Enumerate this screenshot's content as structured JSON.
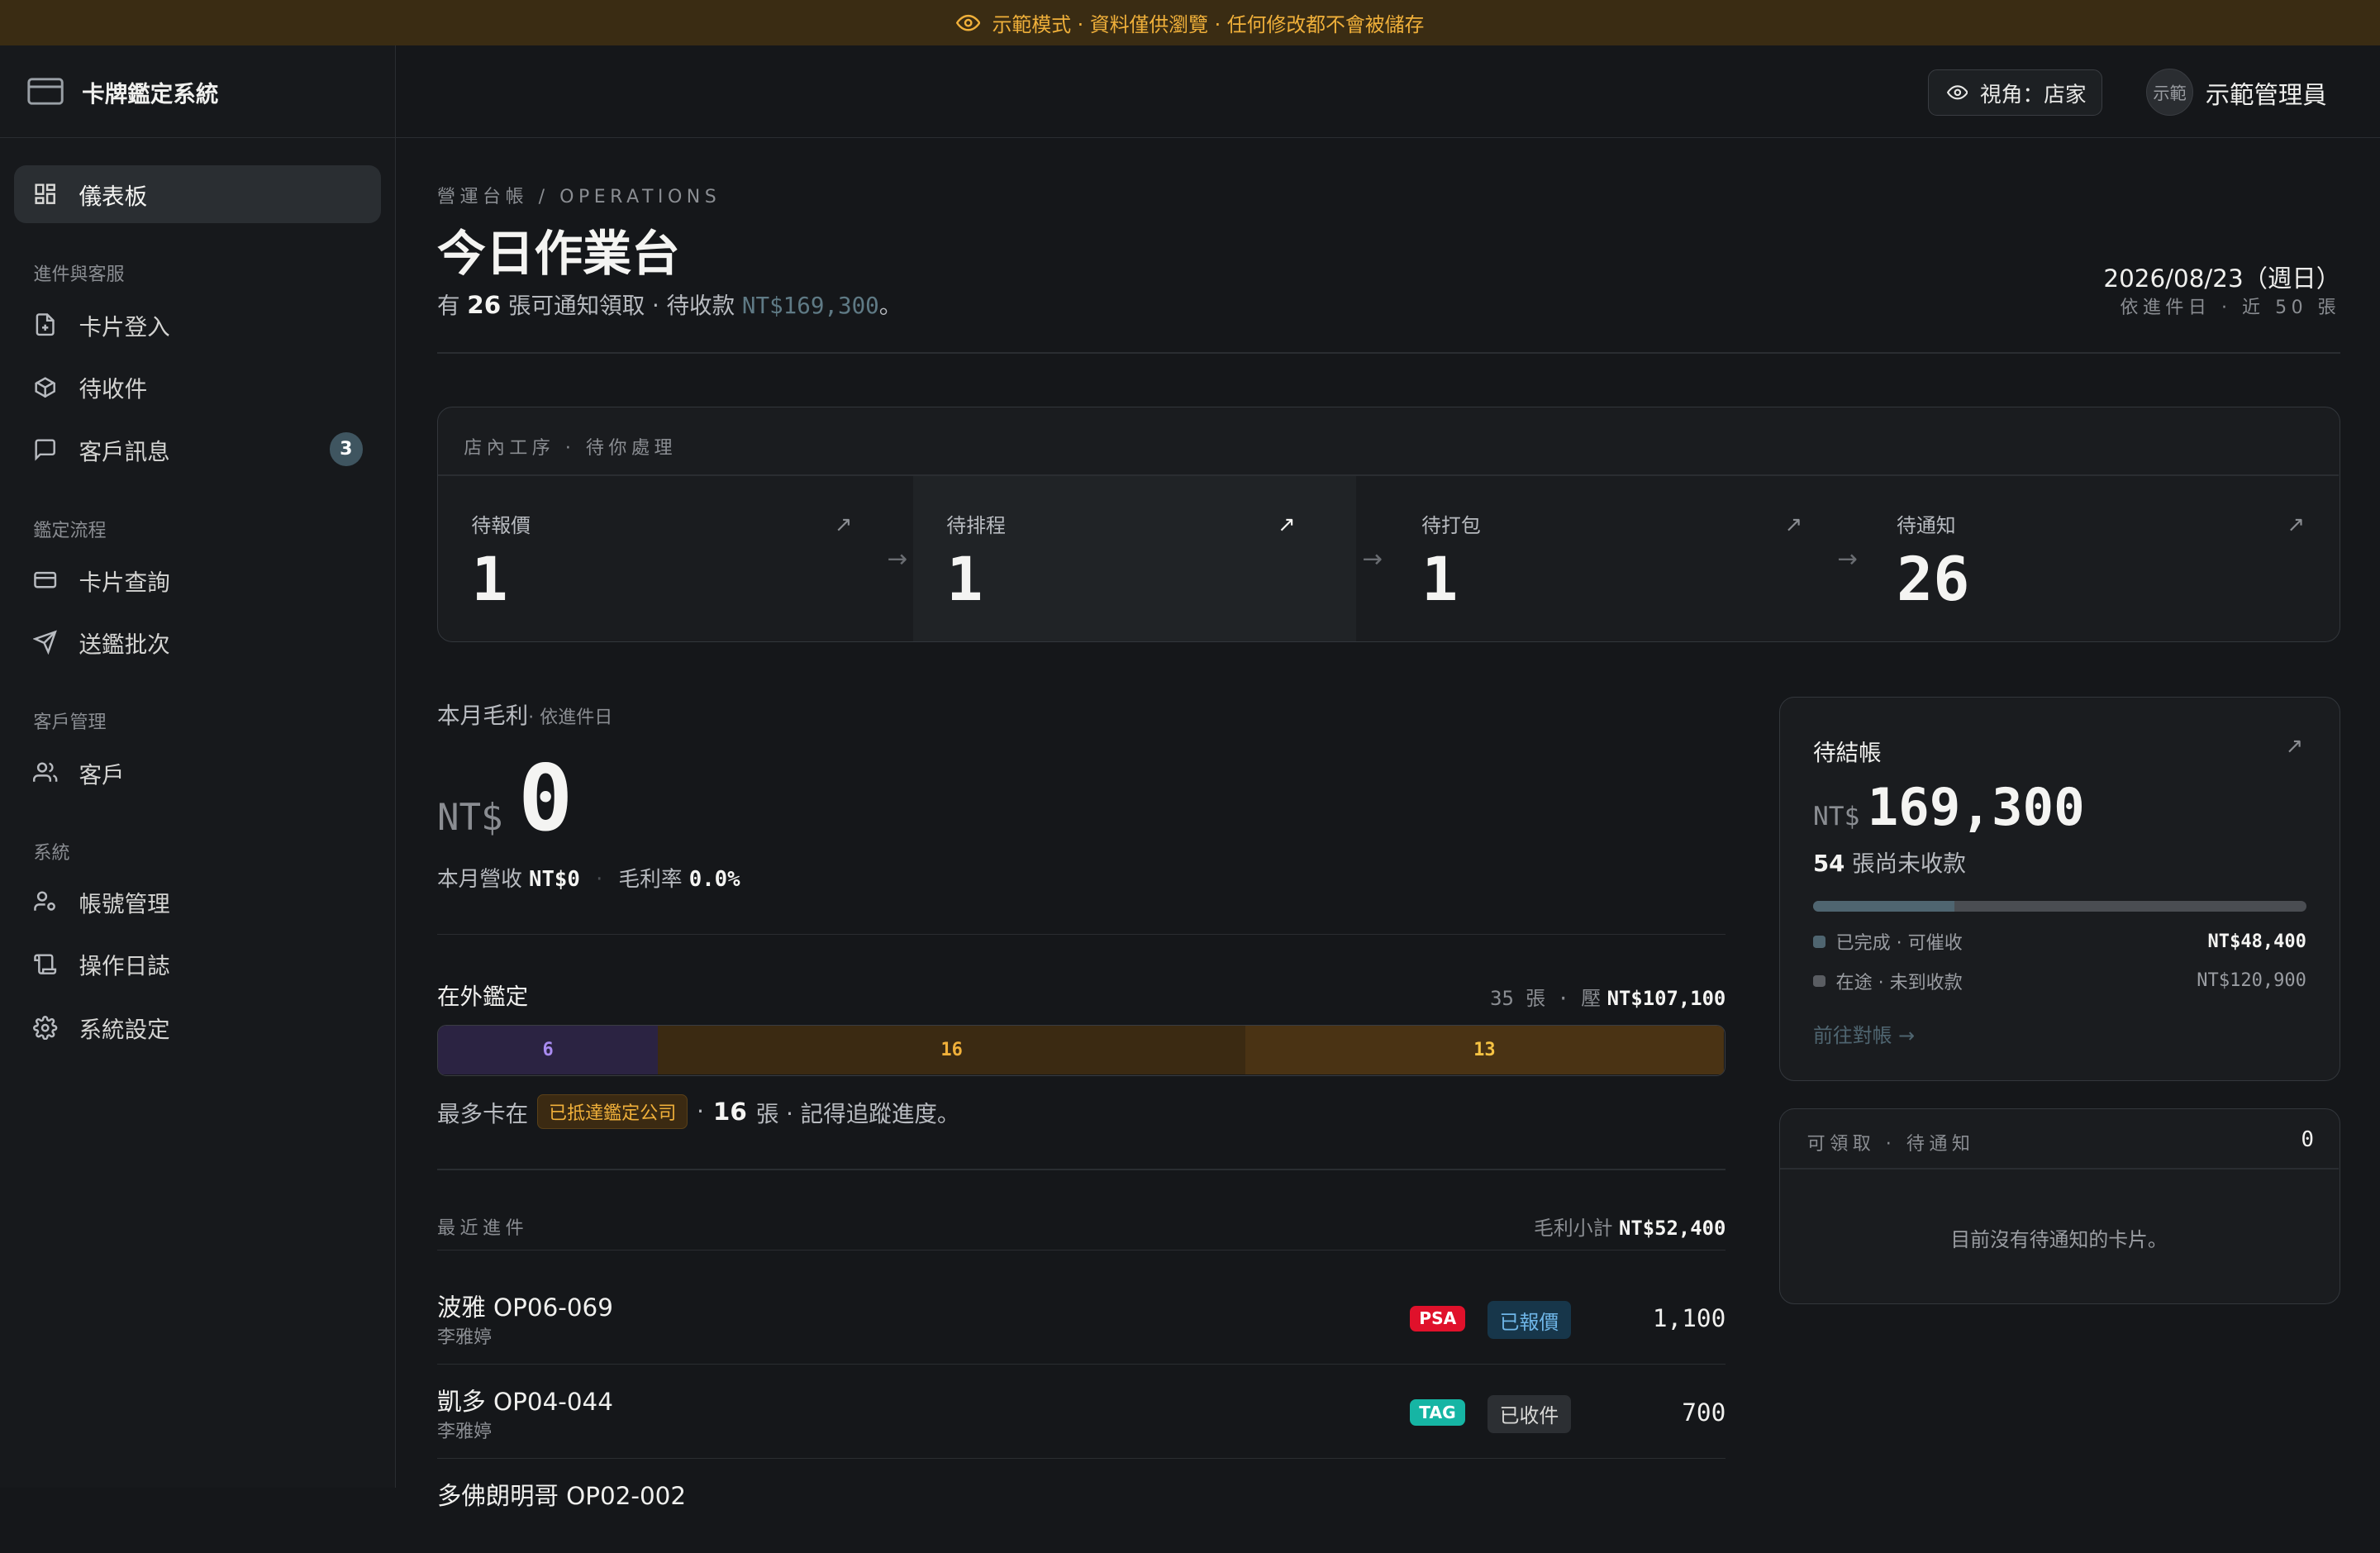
{
  "banner": {
    "text": "示範模式 · 資料僅供瀏覽 · 任何修改都不會被儲存"
  },
  "app": {
    "title": "卡牌鑑定系統"
  },
  "sidebar": {
    "dashboard": "儀表板",
    "groups": [
      {
        "label": "進件與客服",
        "items": [
          {
            "label": "卡片登入"
          },
          {
            "label": "待收件"
          },
          {
            "label": "客戶訊息",
            "badge": "3"
          }
        ]
      },
      {
        "label": "鑑定流程",
        "items": [
          {
            "label": "卡片查詢"
          },
          {
            "label": "送鑑批次"
          }
        ]
      },
      {
        "label": "客戶管理",
        "items": [
          {
            "label": "客戶"
          }
        ]
      },
      {
        "label": "系統",
        "items": [
          {
            "label": "帳號管理"
          },
          {
            "label": "操作日誌"
          },
          {
            "label": "系統設定"
          }
        ]
      }
    ]
  },
  "topbar": {
    "view_label": "視角：店家",
    "avatar_text": "示範",
    "user_name": "示範管理員"
  },
  "header": {
    "breadcrumb": "營運台帳 / OPERATIONS",
    "title": "今日作業台",
    "summary_prefix": "有",
    "summary_count": "26",
    "summary_mid": "張可通知領取 · 待收款",
    "summary_amount": "NT$169,300",
    "summary_suffix": "。",
    "date": "2026/08/23（週日）",
    "date_sub": "依進件日 · 近 50 張"
  },
  "pipeline": {
    "title": "店內工序 · 待你處理",
    "stages": [
      {
        "label": "待報價",
        "value": "1"
      },
      {
        "label": "待排程",
        "value": "1"
      },
      {
        "label": "待打包",
        "value": "1"
      },
      {
        "label": "待通知",
        "value": "26"
      }
    ]
  },
  "profit": {
    "label": "本月毛利",
    "label_sub": "· 依進件日",
    "currency": "NT$",
    "value": "0",
    "revenue_label": "本月營收",
    "revenue_value": "NT$0",
    "margin_label": "毛利率",
    "margin_value": "0.0%"
  },
  "grading": {
    "title": "在外鑑定",
    "count_text": "35 張 · 壓",
    "amount": "NT$107,100",
    "segments": [
      {
        "value": 6,
        "color": "#2b2342",
        "text_color": "#a98bf0"
      },
      {
        "value": 16,
        "color": "#3b2a12",
        "text_color": "#f0b03a"
      },
      {
        "value": 13,
        "color": "#4a3314",
        "text_color": "#f6c343"
      }
    ],
    "note_prefix": "最多卡在",
    "note_tag": "已抵達鑑定公司",
    "note_mid": "·",
    "note_count": "16",
    "note_suffix": "張 · 記得追蹤進度。"
  },
  "recent": {
    "title": "最近進件",
    "subtotal_label": "毛利小計",
    "subtotal_value": "NT$52,400",
    "rows": [
      {
        "title": "波雅 OP06-069",
        "customer": "李雅婷",
        "grader": "PSA",
        "grader_color": "#e0112b",
        "status": "已報價",
        "status_bg": "#17364a",
        "status_color": "#6fb6e8",
        "amount": "1,100"
      },
      {
        "title": "凱多 OP04-044",
        "customer": "李雅婷",
        "grader": "TAG",
        "grader_color": "#16b5a4",
        "status": "已收件",
        "status_bg": "#2c2f33",
        "status_color": "#d8d8d6",
        "amount": "700"
      },
      {
        "title": "多佛朗明哥 OP02-002",
        "customer": "",
        "grader": "",
        "grader_color": "",
        "status": "",
        "status_bg": "",
        "status_color": "",
        "amount": ""
      }
    ]
  },
  "receivable": {
    "title": "待結帳",
    "currency": "NT$",
    "amount": "169,300",
    "count": "54",
    "count_suffix": "張尚未收款",
    "progress": 0.286,
    "legend": [
      {
        "label": "已完成 · 可催收",
        "value": "NT$48,400",
        "color": "#4f6570"
      },
      {
        "label": "在途 · 未到收款",
        "value": "NT$120,900",
        "color": "#5a5d62"
      }
    ],
    "link": "前往對帳 →"
  },
  "pickup": {
    "title": "可領取 · 待通知",
    "count": "0",
    "empty": "目前沒有待通知的卡片。"
  }
}
